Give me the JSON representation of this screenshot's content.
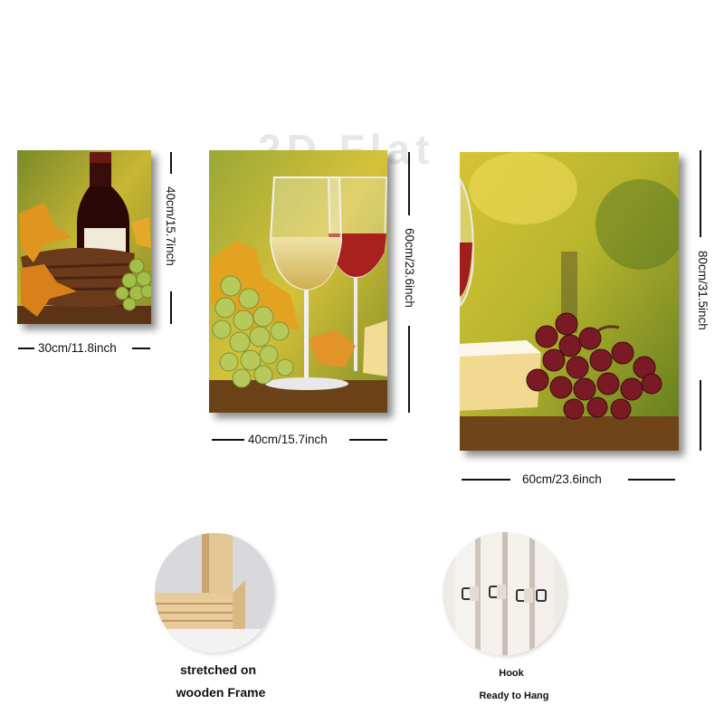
{
  "watermark": "2D Flat",
  "panels": [
    {
      "width_label": "30cm/11.8inch",
      "height_label": "40cm/15.7inch",
      "image": "red wine bottle with autumn leaves, basket and green grapes"
    },
    {
      "width_label": "40cm/15.7inch",
      "height_label": "60cm/23.6inch",
      "image": "white and red wine glasses with green grapes and autumn leaves"
    },
    {
      "width_label": "60cm/23.6inch",
      "height_label": "80cm/31.5inch",
      "image": "red grapes and cheese on wooden table in vineyard"
    }
  ],
  "features": [
    {
      "image": "wooden frame corner",
      "caption_line1": "stretched on",
      "caption_line2": "wooden Frame"
    },
    {
      "image": "canvas back with hooks",
      "caption_line1": "Hook",
      "caption_line2": "Ready to Hang"
    }
  ]
}
